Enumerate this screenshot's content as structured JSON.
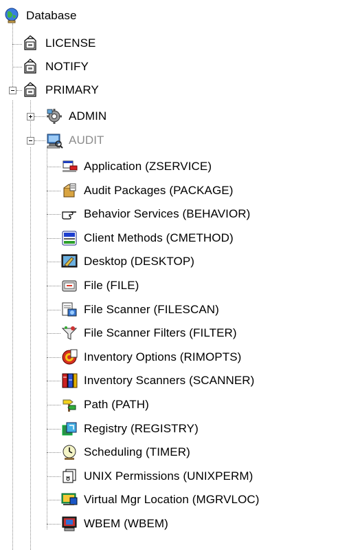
{
  "tree": {
    "root": {
      "label": "Database",
      "icon": "globe-database-icon"
    },
    "children": [
      {
        "label": "LICENSE",
        "icon": "folder-lock-icon"
      },
      {
        "label": "NOTIFY",
        "icon": "folder-lock-icon"
      },
      {
        "label": "PRIMARY",
        "icon": "folder-lock-icon",
        "expanded": true,
        "children": [
          {
            "label": "ADMIN",
            "icon": "admin-gear-icon",
            "expanded": false
          },
          {
            "label": "AUDIT",
            "icon": "audit-computer-icon",
            "expanded": true,
            "selected": true,
            "children": [
              {
                "label": "Application (ZSERVICE)",
                "icon": "application-icon"
              },
              {
                "label": "Audit Packages (PACKAGE)",
                "icon": "audit-packages-icon"
              },
              {
                "label": "Behavior Services (BEHAVIOR)",
                "icon": "pointing-hand-icon"
              },
              {
                "label": "Client Methods (CMETHOD)",
                "icon": "client-methods-icon"
              },
              {
                "label": "Desktop (DESKTOP)",
                "icon": "desktop-icon"
              },
              {
                "label": "File (FILE)",
                "icon": "file-icon"
              },
              {
                "label": "File Scanner (FILESCAN)",
                "icon": "file-scanner-icon"
              },
              {
                "label": "File Scanner Filters (FILTER)",
                "icon": "filter-icon"
              },
              {
                "label": "Inventory Options (RIMOPTS)",
                "icon": "inventory-options-icon"
              },
              {
                "label": "Inventory Scanners (SCANNER)",
                "icon": "inventory-scanners-icon"
              },
              {
                "label": "Path (PATH)",
                "icon": "path-icon"
              },
              {
                "label": "Registry (REGISTRY)",
                "icon": "registry-icon"
              },
              {
                "label": "Scheduling (TIMER)",
                "icon": "scheduling-icon"
              },
              {
                "label": "UNIX Permissions (UNIXPERM)",
                "icon": "unix-permissions-icon"
              },
              {
                "label": "Virtual Mgr Location (MGRVLOC)",
                "icon": "virtual-mgr-location-icon"
              },
              {
                "label": "WBEM (WBEM)",
                "icon": "wbem-icon"
              }
            ]
          }
        ]
      }
    ]
  },
  "colors": {
    "selected_text": "#8c8c8c",
    "tree_line": "#8a8a8a"
  }
}
